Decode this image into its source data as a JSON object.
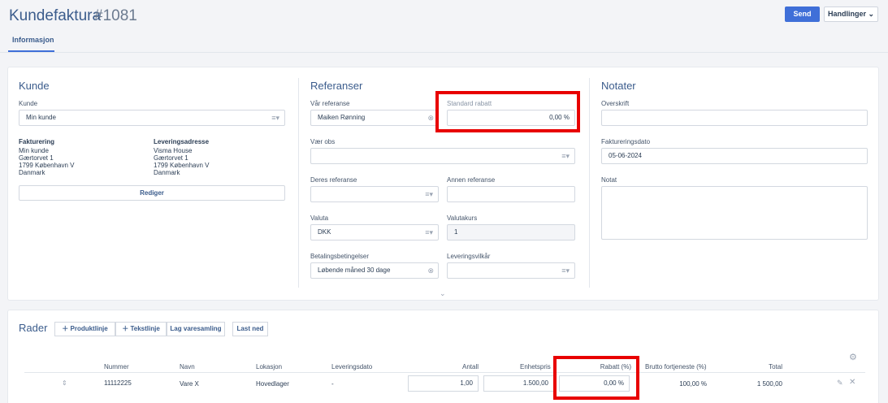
{
  "header": {
    "title": "Kundefaktura",
    "number": "#1081",
    "send_label": "Send",
    "actions_label": "Handlinger"
  },
  "tabs": [
    {
      "label": "Informasjon"
    }
  ],
  "kunde": {
    "title": "Kunde",
    "field_label": "Kunde",
    "field_value": "Min kunde",
    "billing": {
      "title": "Fakturering",
      "lines": [
        "Min kunde",
        "Gærtorvet 1",
        "1799 København V",
        "Danmark"
      ]
    },
    "delivery": {
      "title": "Leveringsadresse",
      "lines": [
        "Visma House",
        "Gærtorvet 1",
        "1799 København V",
        "Danmark"
      ]
    },
    "edit_label": "Rediger"
  },
  "referanser": {
    "title": "Referanser",
    "var_ref_label": "Vår referanse",
    "var_ref_value": "Maiken Rønning",
    "std_rabatt_label": "Standard rabatt",
    "std_rabatt_value": "0,00",
    "std_rabatt_unit": "%",
    "var_obs_label": "Vær obs",
    "deres_ref_label": "Deres referanse",
    "annen_ref_label": "Annen referanse",
    "valuta_label": "Valuta",
    "valuta_value": "DKK",
    "valutakurs_label": "Valutakurs",
    "valutakurs_value": "1",
    "betaling_label": "Betalingsbetingelser",
    "betaling_value": "Løbende måned 30 dage",
    "levering_label": "Leveringsvilkår"
  },
  "notater": {
    "title": "Notater",
    "overskrift_label": "Overskrift",
    "fakturadato_label": "Faktureringsdato",
    "fakturadato_value": "05-06-2024",
    "notat_label": "Notat"
  },
  "rader": {
    "title": "Rader",
    "buttons": {
      "produktlinje": "Produktlinje",
      "tekstlinje": "Tekstlinje",
      "varesamling": "Lag varesamling",
      "last_ned": "Last ned"
    },
    "columns": [
      "Nummer",
      "Navn",
      "Lokasjon",
      "Leveringsdato",
      "Antall",
      "Enhetspris",
      "Rabatt (%)",
      "Brutto fortjeneste (%)",
      "Total"
    ],
    "rows": [
      {
        "nummer": "11112225",
        "navn": "Vare X",
        "lokasjon": "Hovedlager",
        "leveringsdato": "-",
        "antall": "1,00",
        "enhetspris": "1.500,00",
        "rabatt": "0,00",
        "rabatt_unit": "%",
        "brutto": "100,00 %",
        "total": "1 500,00"
      }
    ]
  },
  "colors": {
    "accent": "#3f6fd8",
    "highlight": "#e80000",
    "title": "#3b5c8c"
  }
}
